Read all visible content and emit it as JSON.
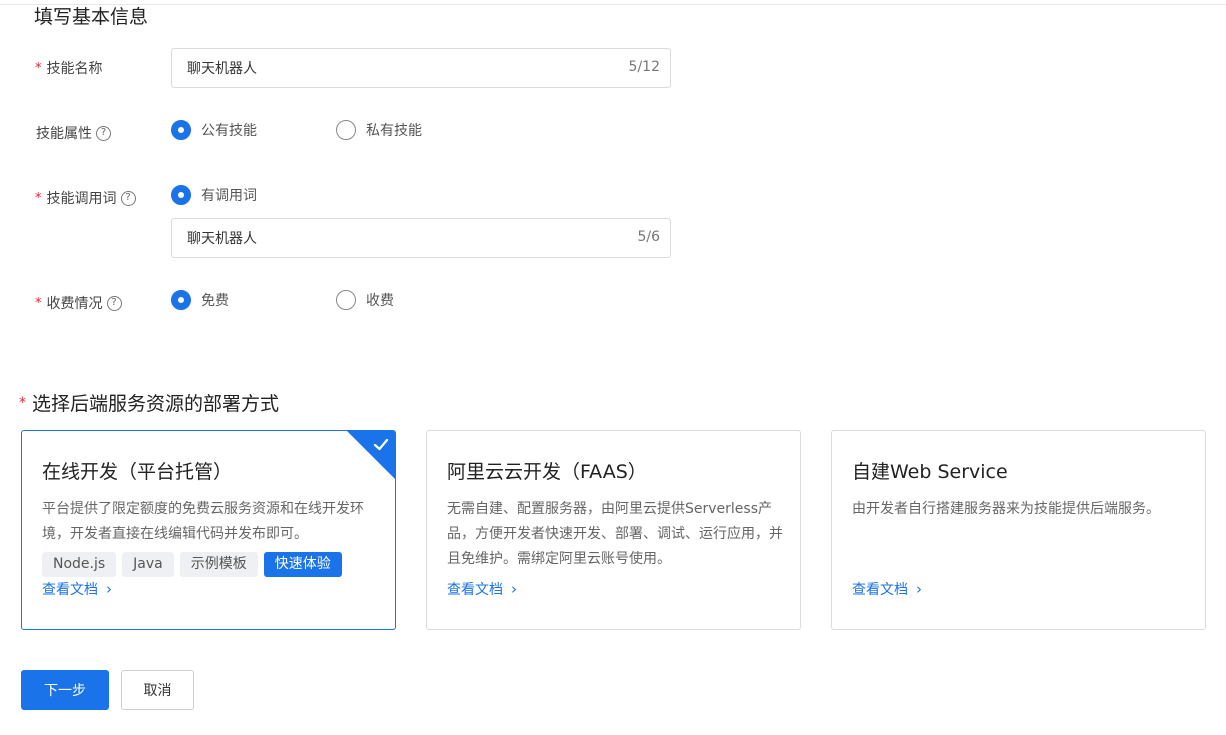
{
  "form": {
    "section_title": "填写基本信息",
    "required_mark": "*",
    "help_mark": "?",
    "skill_name": {
      "label": "技能名称",
      "value": "聊天机器人",
      "count": "5/12"
    },
    "skill_attr": {
      "label": "技能属性",
      "options": [
        "公有技能",
        "私有技能"
      ],
      "selected": "公有技能"
    },
    "invoke_word": {
      "label": "技能调用词",
      "option": "有调用词",
      "value": "聊天机器人",
      "count": "5/6"
    },
    "charge": {
      "label": "收费情况",
      "options": [
        "免费",
        "收费"
      ],
      "selected": "免费"
    }
  },
  "deploy": {
    "title": "选择后端服务资源的部署方式",
    "cards": [
      {
        "title": "在线开发（平台托管）",
        "desc": "平台提供了限定额度的免费云服务资源和在线开发环境，开发者直接在线编辑代码并发布即可。",
        "tags": [
          "Node.js",
          "Java",
          "示例模板",
          "快速体验"
        ],
        "link": "查看文档",
        "selected": true
      },
      {
        "title": "阿里云云开发（FAAS）",
        "desc": "无需自建、配置服务器，由阿里云提供Serverless产品，方便开发者快速开发、部署、调试、运行应用，并且免维护。需绑定阿里云账号使用。",
        "link": "查看文档",
        "selected": false
      },
      {
        "title": "自建Web Service",
        "desc": "由开发者自行搭建服务器来为技能提供后端服务。",
        "link": "查看文档",
        "selected": false
      }
    ]
  },
  "buttons": {
    "next": "下一步",
    "cancel": "取消"
  },
  "colors": {
    "primary": "#1a73e8",
    "required": "#f5222d"
  }
}
